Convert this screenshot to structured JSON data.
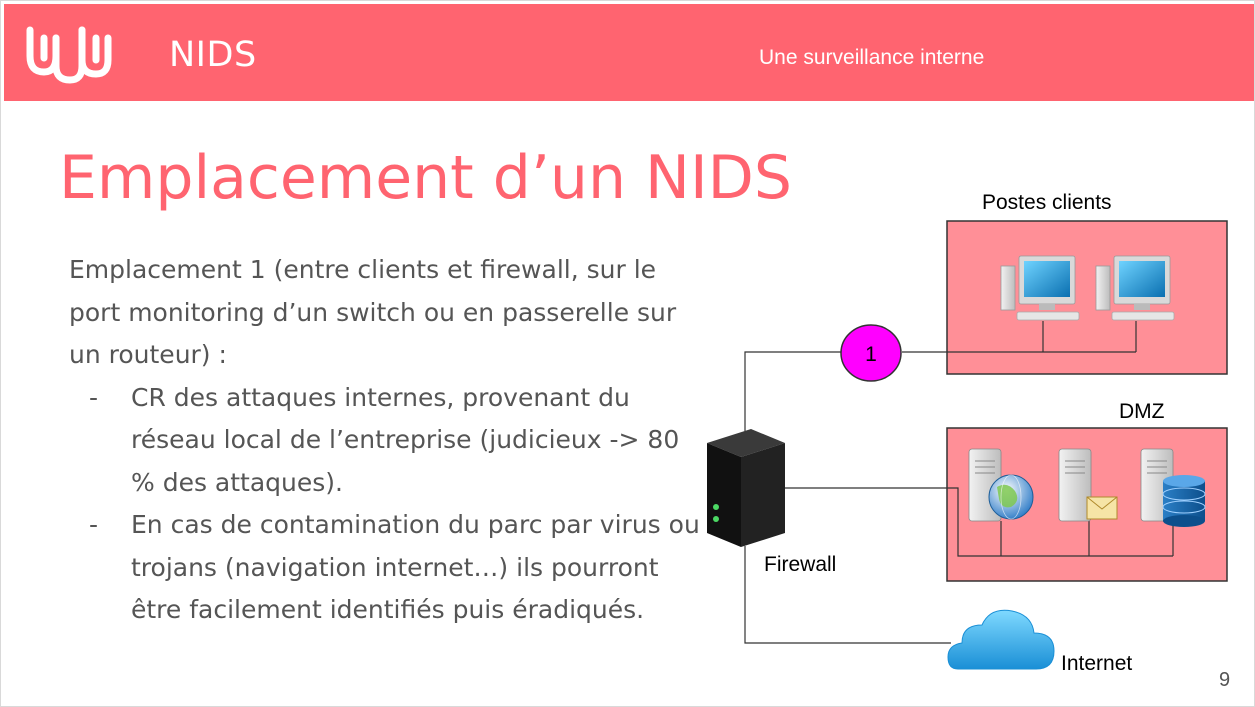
{
  "header": {
    "brand": "NIDS",
    "tagline": "Une surveillance interne",
    "background": "#ff6470"
  },
  "title": "Emplacement d’un NIDS",
  "content": {
    "intro": "Emplacement 1 (entre clients et firewall, sur le port monitoring d’un switch ou en passerelle sur un routeur) :",
    "bullets": [
      "CR des attaques internes, provenant du réseau local de l’entreprise (judicieux -> 80 % des attaques).",
      "En cas de contamination du parc par virus ou trojans (navigation internet…) ils pourront être facilement identifiés puis éradiqués."
    ],
    "bullet_marker": "-"
  },
  "diagram": {
    "clients_label": "Postes clients",
    "dmz_label": "DMZ",
    "firewall_label": "Firewall",
    "internet_label": "Internet",
    "nids_marker": "1",
    "zone_fill": "#ff8f97",
    "marker_fill": "#ff00ff",
    "icons": [
      "computer-icon",
      "server-icon",
      "globe-icon",
      "mail-icon",
      "database-icon",
      "cloud-icon",
      "firewall-icon"
    ]
  },
  "page_number": "9"
}
